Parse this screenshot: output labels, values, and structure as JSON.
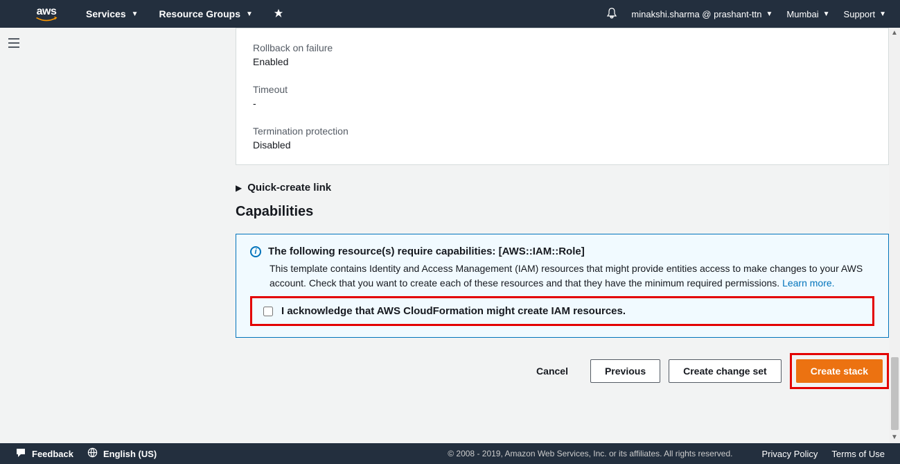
{
  "nav": {
    "logo_text": "aws",
    "services": "Services",
    "resource_groups": "Resource Groups",
    "user": "minakshi.sharma @ prashant-ttn",
    "region": "Mumbai",
    "support": "Support"
  },
  "card": {
    "rollback_label": "Rollback on failure",
    "rollback_value": "Enabled",
    "timeout_label": "Timeout",
    "timeout_value": "-",
    "termination_label": "Termination protection",
    "termination_value": "Disabled"
  },
  "expand": {
    "label": "Quick-create link"
  },
  "section": {
    "capabilities": "Capabilities"
  },
  "alert": {
    "title": "The following resource(s) require capabilities: [AWS::IAM::Role]",
    "body_pre": "This template contains Identity and Access Management (IAM) resources that might provide entities access to make changes to your AWS account. Check that you want to create each of these resources and that they have the minimum required permissions. ",
    "learn_more": "Learn more.",
    "ack_label": "I acknowledge that AWS CloudFormation might create IAM resources."
  },
  "buttons": {
    "cancel": "Cancel",
    "previous": "Previous",
    "change_set": "Create change set",
    "create_stack": "Create stack"
  },
  "footer": {
    "feedback": "Feedback",
    "language": "English (US)",
    "copyright": "© 2008 - 2019, Amazon Web Services, Inc. or its affiliates. All rights reserved.",
    "privacy": "Privacy Policy",
    "terms": "Terms of Use"
  }
}
